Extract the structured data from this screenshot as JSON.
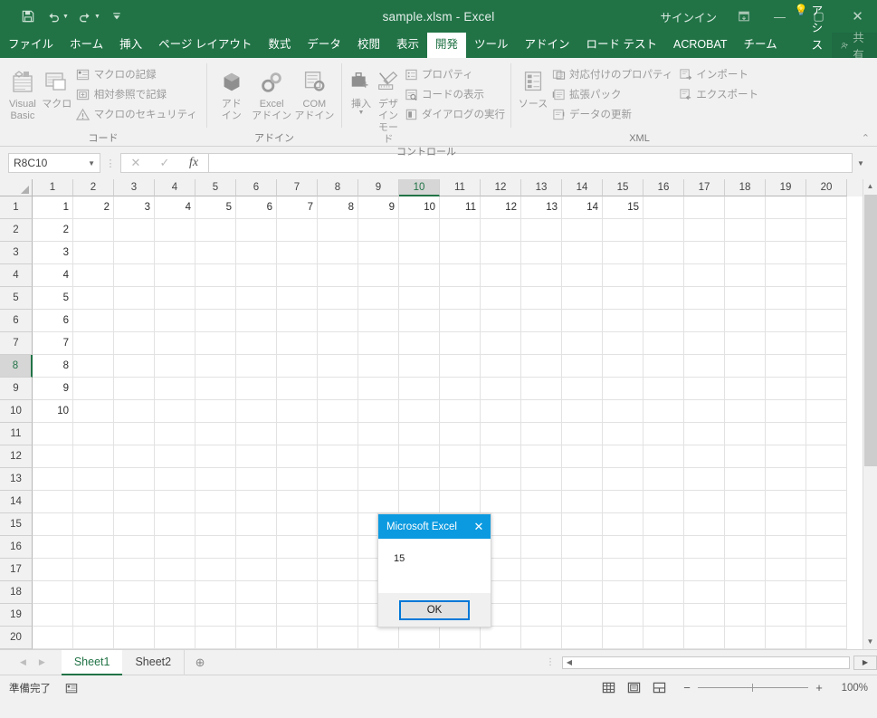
{
  "window": {
    "title": "sample.xlsm  -  Excel",
    "signin_label": "サインイン",
    "ribbon_display_icon": "ribbon-display-options-icon",
    "minimize_icon": "minimize-icon",
    "maximize_icon": "maximize-icon",
    "close_icon": "close-icon",
    "accent_green": "#217346"
  },
  "quick_access": {
    "save_icon": "save-icon",
    "undo_icon": "undo-icon",
    "redo_icon": "redo-icon",
    "customize_icon": "customize-quick-access-icon"
  },
  "ribbon": {
    "tabs": [
      {
        "label": "ファイル",
        "active": false
      },
      {
        "label": "ホーム",
        "active": false
      },
      {
        "label": "挿入",
        "active": false
      },
      {
        "label": "ページ レイアウト",
        "active": false
      },
      {
        "label": "数式",
        "active": false
      },
      {
        "label": "データ",
        "active": false
      },
      {
        "label": "校閲",
        "active": false
      },
      {
        "label": "表示",
        "active": false
      },
      {
        "label": "開発",
        "active": true
      },
      {
        "label": "ツール",
        "active": false
      },
      {
        "label": "アドイン",
        "active": false
      },
      {
        "label": "ロード テスト",
        "active": false
      },
      {
        "label": "ACROBAT",
        "active": false
      },
      {
        "label": "チーム",
        "active": false
      }
    ],
    "tell_me": "操作アシス",
    "share_label": "共有",
    "collapse_label": "⌃",
    "groups": [
      {
        "title": "コード",
        "big_buttons": [
          {
            "label": "Visual Basic",
            "icon": "visual-basic-icon"
          },
          {
            "label": "マクロ",
            "icon": "macros-icon"
          }
        ],
        "small_buttons": [
          {
            "label": "マクロの記録",
            "icon": "record-macro-icon"
          },
          {
            "label": "相対参照で記録",
            "icon": "use-relative-references-icon"
          },
          {
            "label": "マクロのセキュリティ",
            "icon": "macro-security-icon"
          }
        ]
      },
      {
        "title": "アドイン",
        "big_buttons": [
          {
            "label": "アド\nイン",
            "icon": "add-ins-icon"
          },
          {
            "label": "Excel\nアドイン",
            "icon": "excel-add-ins-icon"
          },
          {
            "label": "COM\nアドイン",
            "icon": "com-add-ins-icon"
          }
        ],
        "small_buttons": []
      },
      {
        "title": "コントロール",
        "big_buttons": [
          {
            "label": "挿入",
            "icon": "insert-control-icon"
          },
          {
            "label": "デザイン\nモード",
            "icon": "design-mode-icon"
          }
        ],
        "small_buttons": [
          {
            "label": "プロパティ",
            "icon": "properties-icon"
          },
          {
            "label": "コードの表示",
            "icon": "view-code-icon"
          },
          {
            "label": "ダイアログの実行",
            "icon": "run-dialog-icon"
          }
        ]
      },
      {
        "title": "XML",
        "big_buttons": [
          {
            "label": "ソース",
            "icon": "xml-source-icon"
          }
        ],
        "small_buttons": [
          {
            "label": "対応付けのプロパティ",
            "icon": "map-properties-icon"
          },
          {
            "label": "拡張パック",
            "icon": "expansion-packs-icon"
          },
          {
            "label": "データの更新",
            "icon": "refresh-data-icon"
          },
          {
            "label": "インポート",
            "icon": "import-icon"
          },
          {
            "label": "エクスポート",
            "icon": "export-icon"
          }
        ]
      }
    ]
  },
  "formula_bar": {
    "name_box_value": "R8C10",
    "name_box_caret_icon": "chevron-down-icon",
    "cancel_icon": "cancel-icon",
    "enter_icon": "confirm-icon",
    "function_icon": "insert-function-icon",
    "formula_value": "",
    "expand_icon": "expand-formula-bar-icon"
  },
  "grid": {
    "reference_style": "R1C1",
    "selected_cell": "R8C10",
    "selected_row": 8,
    "selected_column": 10,
    "column_headers": [
      1,
      2,
      3,
      4,
      5,
      6,
      7,
      8,
      9,
      10,
      11,
      12,
      13,
      14,
      15,
      16,
      17,
      18,
      19,
      20
    ],
    "row_headers": [
      1,
      2,
      3,
      4,
      5,
      6,
      7,
      8,
      9,
      10,
      11,
      12,
      13,
      14,
      15,
      16,
      17,
      18,
      19,
      20
    ],
    "cells": [
      [
        "1",
        "2",
        "3",
        "4",
        "5",
        "6",
        "7",
        "8",
        "9",
        "10",
        "11",
        "12",
        "13",
        "14",
        "15",
        "",
        "",
        "",
        "",
        ""
      ],
      [
        "2",
        "",
        "",
        "",
        "",
        "",
        "",
        "",
        "",
        "",
        "",
        "",
        "",
        "",
        "",
        "",
        "",
        "",
        "",
        ""
      ],
      [
        "3",
        "",
        "",
        "",
        "",
        "",
        "",
        "",
        "",
        "",
        "",
        "",
        "",
        "",
        "",
        "",
        "",
        "",
        "",
        ""
      ],
      [
        "4",
        "",
        "",
        "",
        "",
        "",
        "",
        "",
        "",
        "",
        "",
        "",
        "",
        "",
        "",
        "",
        "",
        "",
        "",
        ""
      ],
      [
        "5",
        "",
        "",
        "",
        "",
        "",
        "",
        "",
        "",
        "",
        "",
        "",
        "",
        "",
        "",
        "",
        "",
        "",
        "",
        ""
      ],
      [
        "6",
        "",
        "",
        "",
        "",
        "",
        "",
        "",
        "",
        "",
        "",
        "",
        "",
        "",
        "",
        "",
        "",
        "",
        "",
        ""
      ],
      [
        "7",
        "",
        "",
        "",
        "",
        "",
        "",
        "",
        "",
        "",
        "",
        "",
        "",
        "",
        "",
        "",
        "",
        "",
        "",
        ""
      ],
      [
        "8",
        "",
        "",
        "",
        "",
        "",
        "",
        "",
        "",
        "",
        "",
        "",
        "",
        "",
        "",
        "",
        "",
        "",
        "",
        ""
      ],
      [
        "9",
        "",
        "",
        "",
        "",
        "",
        "",
        "",
        "",
        "",
        "",
        "",
        "",
        "",
        "",
        "",
        "",
        "",
        "",
        ""
      ],
      [
        "10",
        "",
        "",
        "",
        "",
        "",
        "",
        "",
        "",
        "",
        "",
        "",
        "",
        "",
        "",
        "",
        "",
        "",
        "",
        ""
      ],
      [
        "",
        "",
        "",
        "",
        "",
        "",
        "",
        "",
        "",
        "",
        "",
        "",
        "",
        "",
        "",
        "",
        "",
        "",
        "",
        ""
      ],
      [
        "",
        "",
        "",
        "",
        "",
        "",
        "",
        "",
        "",
        "",
        "",
        "",
        "",
        "",
        "",
        "",
        "",
        "",
        "",
        ""
      ],
      [
        "",
        "",
        "",
        "",
        "",
        "",
        "",
        "",
        "",
        "",
        "",
        "",
        "",
        "",
        "",
        "",
        "",
        "",
        "",
        ""
      ],
      [
        "",
        "",
        "",
        "",
        "",
        "",
        "",
        "",
        "",
        "",
        "",
        "",
        "",
        "",
        "",
        "",
        "",
        "",
        "",
        ""
      ],
      [
        "",
        "",
        "",
        "",
        "",
        "",
        "",
        "",
        "",
        "",
        "",
        "",
        "",
        "",
        "",
        "",
        "",
        "",
        "",
        ""
      ],
      [
        "",
        "",
        "",
        "",
        "",
        "",
        "",
        "",
        "",
        "",
        "",
        "",
        "",
        "",
        "",
        "",
        "",
        "",
        "",
        ""
      ],
      [
        "",
        "",
        "",
        "",
        "",
        "",
        "",
        "",
        "",
        "",
        "",
        "",
        "",
        "",
        "",
        "",
        "",
        "",
        "",
        ""
      ],
      [
        "",
        "",
        "",
        "",
        "",
        "",
        "",
        "",
        "",
        "",
        "",
        "",
        "",
        "",
        "",
        "",
        "",
        "",
        "",
        ""
      ],
      [
        "",
        "",
        "",
        "",
        "",
        "",
        "",
        "",
        "",
        "",
        "",
        "",
        "",
        "",
        "",
        "",
        "",
        "",
        "",
        ""
      ],
      [
        "",
        "",
        "",
        "",
        "",
        "",
        "",
        "",
        "",
        "",
        "",
        "",
        "",
        "",
        "",
        "",
        "",
        "",
        "",
        ""
      ]
    ]
  },
  "dialog": {
    "title": "Microsoft Excel",
    "close_icon": "close-icon",
    "message": "15",
    "ok_label": "OK",
    "title_color": "#0b9ae0",
    "button_border_color": "#0078d7"
  },
  "sheet_tabs": {
    "prev_icon": "previous-sheet-icon",
    "next_icon": "next-sheet-icon",
    "tabs": [
      {
        "label": "Sheet1",
        "active": true
      },
      {
        "label": "Sheet2",
        "active": false
      }
    ],
    "add_sheet_icon": "add-sheet-icon"
  },
  "status_bar": {
    "status_text": "準備完了",
    "macro_record_icon": "record-macro-status-icon",
    "views": [
      {
        "icon": "normal-view-icon",
        "active": true
      },
      {
        "icon": "page-layout-view-icon",
        "active": false
      },
      {
        "icon": "page-break-preview-icon",
        "active": false
      }
    ],
    "zoom_out_label": "−",
    "zoom_in_label": "+",
    "zoom_level": "100%"
  }
}
